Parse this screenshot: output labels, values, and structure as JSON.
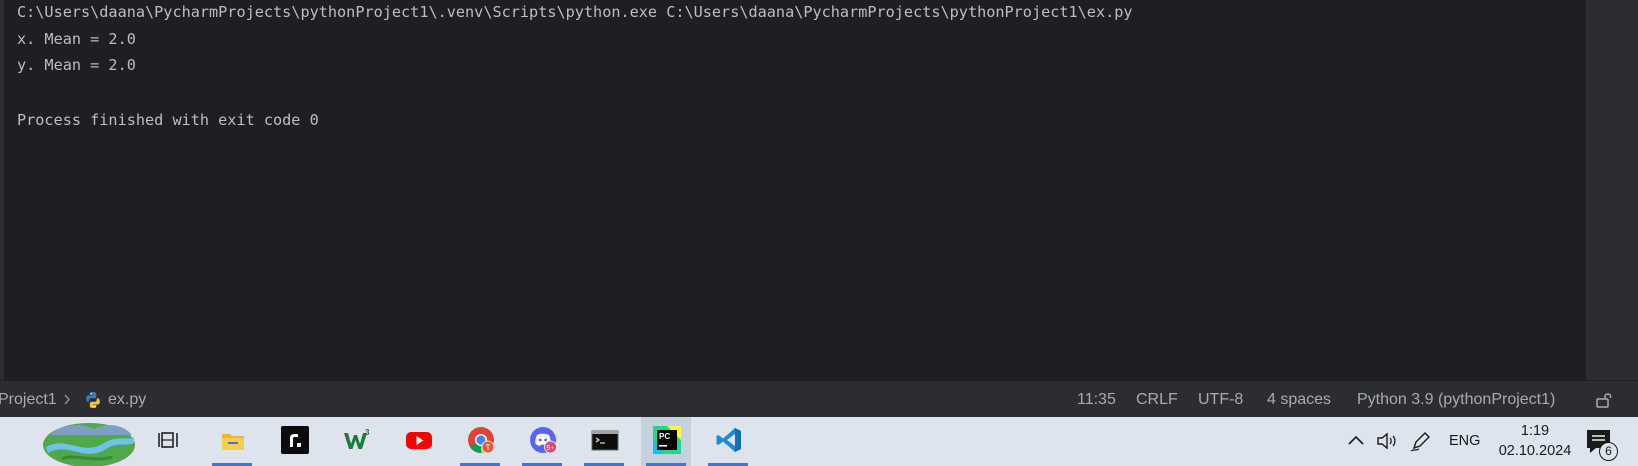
{
  "console": {
    "lines": [
      "C:\\Users\\daana\\PycharmProjects\\pythonProject1\\.venv\\Scripts\\python.exe C:\\Users\\daana\\PycharmProjects\\pythonProject1\\ex.py",
      "x. Mean = 2.0",
      "y. Mean = 2.0",
      "",
      "Process finished with exit code 0"
    ]
  },
  "statusbar": {
    "breadcrumb": {
      "project": "Project1",
      "separator": ">",
      "file": "ex.py"
    },
    "caret_position": "11:35",
    "line_separator": "CRLF",
    "encoding": "UTF-8",
    "indent": "4 spaces",
    "interpreter": "Python 3.9 (pythonProject1)",
    "lock_icon": "unlocked-icon"
  },
  "taskbar": {
    "apps": [
      {
        "name": "task-view-icon"
      },
      {
        "name": "file-explorer-icon"
      },
      {
        "name": "r-app-icon"
      },
      {
        "name": "w3schools-icon"
      },
      {
        "name": "youtube-icon"
      },
      {
        "name": "chrome-icon",
        "badge": "T"
      },
      {
        "name": "discord-icon",
        "badge": "9+"
      },
      {
        "name": "terminal-icon"
      },
      {
        "name": "pycharm-icon",
        "label": "PC"
      },
      {
        "name": "vscode-icon"
      }
    ],
    "tray": {
      "language": "ENG",
      "time": "1:19",
      "date": "02.10.2024",
      "notification_count": "6"
    }
  },
  "colors": {
    "console_bg": "#1e1f22",
    "console_text": "#bcbec4",
    "statusbar_bg": "#2b2d30",
    "taskbar_bg": "#dde4ee",
    "accent": "#3b78d8"
  }
}
